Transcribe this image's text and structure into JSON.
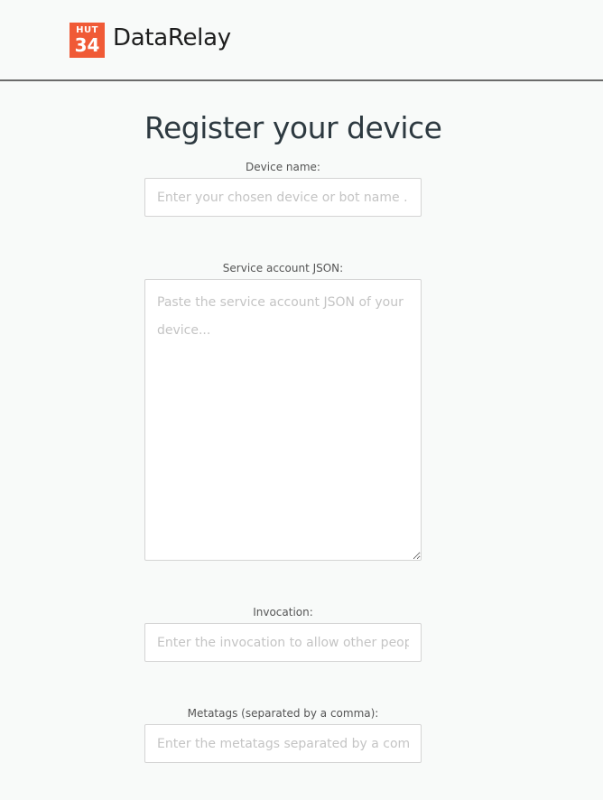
{
  "header": {
    "logo_top": "HUT",
    "logo_bottom": "34",
    "brand": "DataRelay"
  },
  "form": {
    "title": "Register your device",
    "device_name": {
      "label": "Device name:",
      "placeholder": "Enter your chosen device or bot name ..."
    },
    "service_account": {
      "label": "Service account JSON:",
      "placeholder": "Paste the service account JSON of your device..."
    },
    "invocation": {
      "label": "Invocation:",
      "placeholder": "Enter the invocation to allow other people to"
    },
    "metatags": {
      "label": "Metatags (separated by a comma):",
      "placeholder": "Enter the metatags separated by a comma ..."
    }
  },
  "colors": {
    "accent": "#f05a36",
    "background": "#f8faf9",
    "divider": "#6b6b6b"
  }
}
